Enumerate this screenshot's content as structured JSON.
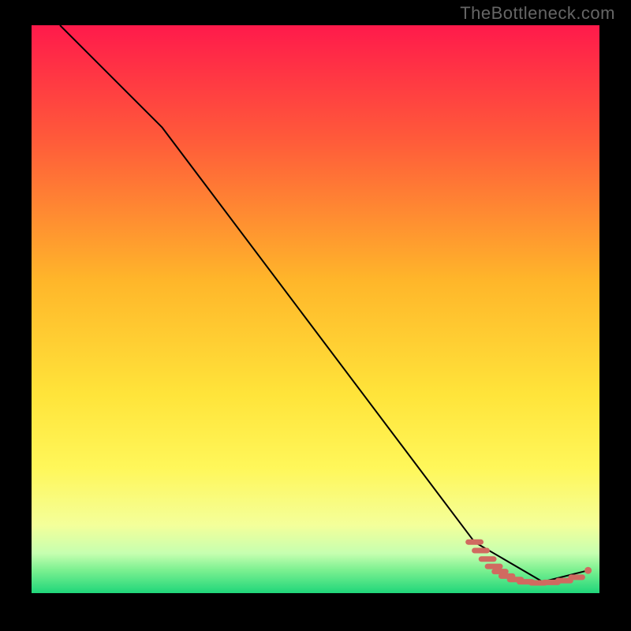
{
  "watermark": "TheBottleneck.com",
  "chart_data": {
    "type": "line",
    "title": "",
    "xlabel": "",
    "ylabel": "",
    "xlim": [
      0,
      100
    ],
    "ylim": [
      0,
      100
    ],
    "grid": false,
    "background_gradient": {
      "stops": [
        {
          "offset": 0,
          "color": "#ff1a4b"
        },
        {
          "offset": 20,
          "color": "#ff5a3a"
        },
        {
          "offset": 45,
          "color": "#ffb62a"
        },
        {
          "offset": 65,
          "color": "#ffe43a"
        },
        {
          "offset": 78,
          "color": "#fff75a"
        },
        {
          "offset": 88,
          "color": "#f4ff9a"
        },
        {
          "offset": 93,
          "color": "#c6ffb0"
        },
        {
          "offset": 96,
          "color": "#7af090"
        },
        {
          "offset": 100,
          "color": "#1fd67a"
        }
      ]
    },
    "series": [
      {
        "name": "bottleneck-curve",
        "style": "line",
        "color": "#000000",
        "x": [
          5,
          23,
          78,
          90,
          98
        ],
        "y": [
          100,
          82,
          9,
          2,
          4
        ]
      },
      {
        "name": "flat-segment-dashes",
        "style": "dash-markers",
        "color": "#d06a60",
        "points": [
          {
            "x": 78.0,
            "y": 9.0,
            "len": 2.2
          },
          {
            "x": 79.1,
            "y": 7.5,
            "len": 2.2
          },
          {
            "x": 80.3,
            "y": 6.0,
            "len": 2.2
          },
          {
            "x": 81.4,
            "y": 4.7,
            "len": 2.2
          },
          {
            "x": 82.5,
            "y": 3.8,
            "len": 2.0
          },
          {
            "x": 83.7,
            "y": 3.0,
            "len": 2.0
          },
          {
            "x": 85.2,
            "y": 2.4,
            "len": 2.0
          },
          {
            "x": 87.0,
            "y": 2.0,
            "len": 2.2
          },
          {
            "x": 89.2,
            "y": 1.8,
            "len": 2.4
          },
          {
            "x": 91.5,
            "y": 1.9,
            "len": 2.4
          },
          {
            "x": 93.8,
            "y": 2.2,
            "len": 2.2
          },
          {
            "x": 96.0,
            "y": 2.8,
            "len": 2.0
          }
        ]
      },
      {
        "name": "endpoint-dot",
        "style": "point",
        "color": "#d06a60",
        "x": [
          98
        ],
        "y": [
          4
        ]
      }
    ]
  }
}
